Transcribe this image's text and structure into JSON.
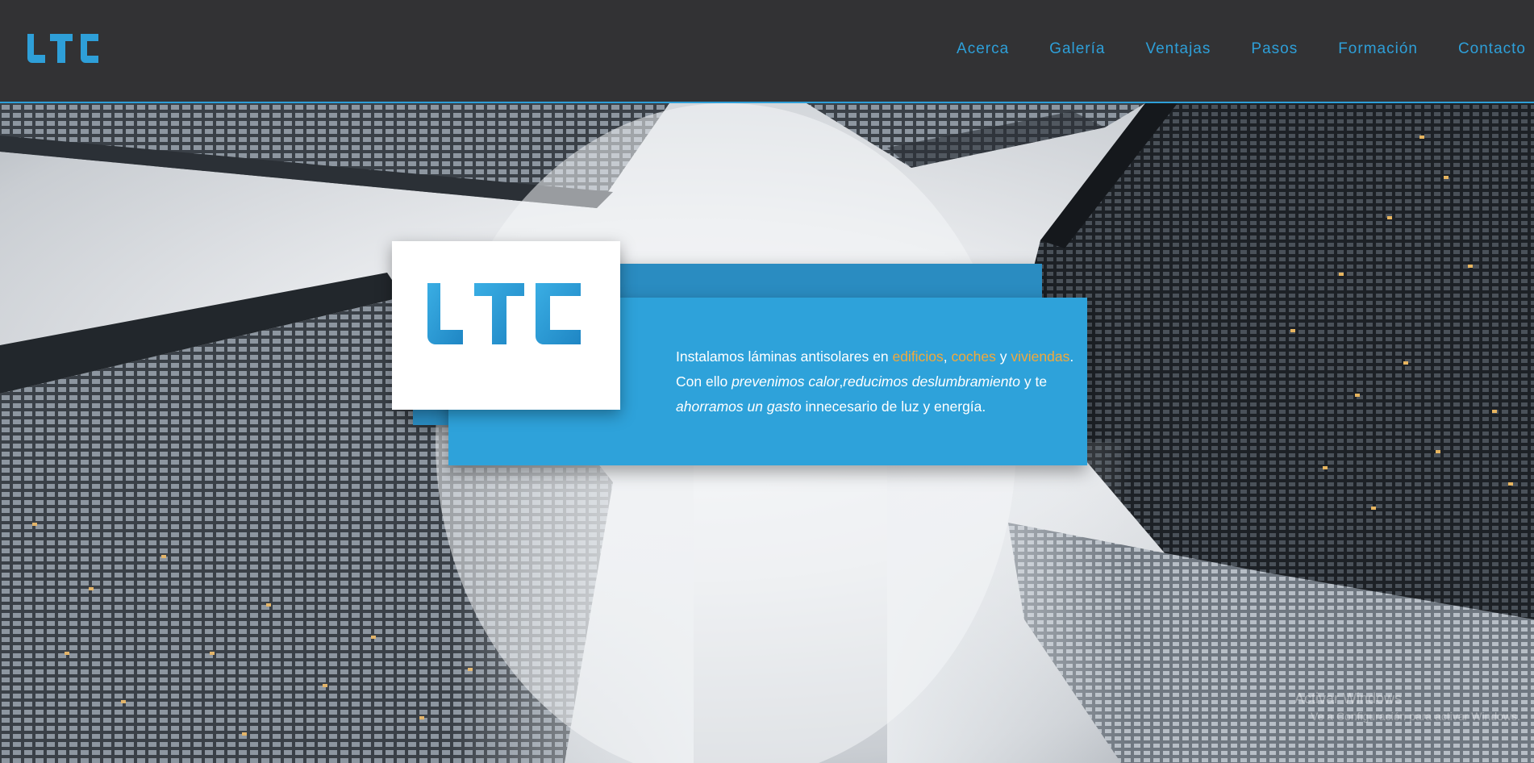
{
  "brand": {
    "logo_text": "LTC",
    "accent_color": "#2e9fd8"
  },
  "nav": {
    "items": [
      {
        "label": "Acerca"
      },
      {
        "label": "Galería"
      },
      {
        "label": "Ventajas"
      },
      {
        "label": "Pasos"
      },
      {
        "label": "Formación"
      },
      {
        "label": "Contacto"
      }
    ]
  },
  "hero": {
    "logo_text": "LTC",
    "line1_a": "Instalamos láminas antisolares en ",
    "link_buildings": "edificios",
    "sep1": ", ",
    "link_cars": "coches",
    "sep2": " y ",
    "link_homes": "viviendas",
    "line1_end": ".",
    "line2_a": "Con ello ",
    "em_heat": "prevenimos calor",
    "sep3": ",",
    "em_glare": "reducimos deslumbramiento",
    "line2_end": " y te",
    "em_saving": "ahorramos un gasto",
    "line3_end": " innecesario de luz y energía.",
    "highlight_color": "#f2a93b",
    "card_color": "#2ea2da"
  },
  "watermark": {
    "title": "Activar Windows",
    "subtitle": "Ve a Configuración para activar Windows."
  }
}
